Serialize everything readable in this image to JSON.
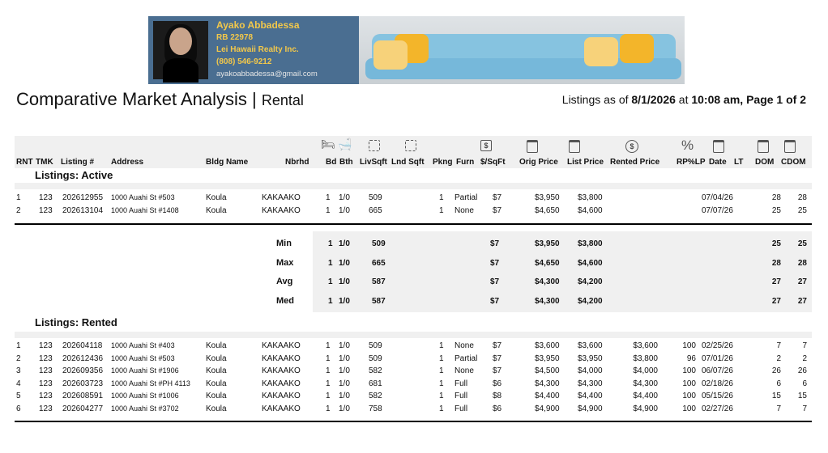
{
  "agent": {
    "name": "Ayako Abbadessa",
    "license": "RB 22978",
    "company": "Lei Hawaii Realty Inc.",
    "phone": "(808) 546-9212",
    "email": "ayakoabbadessa@gmail.com"
  },
  "report": {
    "title": "Comparative Market Analysis",
    "divider": "|",
    "subtitle": "Rental",
    "listings_as_prefix": "Listings as of",
    "date": "8/1/2026",
    "at": "at",
    "time_page": "10:08 am, Page 1 of 2"
  },
  "columns": {
    "rnt": "RNT",
    "tmk": "TMK",
    "listing": "Listing #",
    "address": "Address",
    "bldg": "Bldg Name",
    "nbrhd": "Nbrhd",
    "bd": "Bd",
    "bth": "Bth",
    "livsqft": "LivSqft",
    "lndsqft": "Lnd Sqft",
    "pkng": "Pkng",
    "furn": "Furn",
    "psqft": "$/SqFt",
    "orig": "Orig Price",
    "list": "List Price",
    "rented": "Rented Price",
    "rplp": "RP%LP",
    "date": "Date",
    "lt": "LT",
    "dom": "DOM",
    "cdom": "CDOM"
  },
  "icons": {
    "bed": "bed-icon",
    "bath": "bath-icon",
    "sqft": "area-icon",
    "dollar": "dollar-box-icon",
    "price": "price-tag-icon",
    "coin": "dollar-coin-icon",
    "percent": "percent-icon",
    "calendar": "calendar-icon",
    "percent_glyph": "%",
    "dollar_glyph": "$"
  },
  "active": {
    "heading": "Listings: Active",
    "rows": [
      {
        "n": "1",
        "tmk": "123",
        "listing": "202612955",
        "address": "1000 Auahi St #503",
        "bldg": "Koula",
        "nbrhd": "KAKAAKO",
        "bd": "1",
        "bth": "1/0",
        "liv": "509",
        "pk": "1",
        "furn": "Partial",
        "psf": "$7",
        "orig": "$3,950",
        "list": "$3,800",
        "rented": "",
        "rplp": "",
        "date": "07/04/26",
        "dom": "28",
        "cdom": "28"
      },
      {
        "n": "2",
        "tmk": "123",
        "listing": "202613104",
        "address": "1000 Auahi St #1408",
        "bldg": "Koula",
        "nbrhd": "KAKAAKO",
        "bd": "1",
        "bth": "1/0",
        "liv": "665",
        "pk": "1",
        "furn": "None",
        "psf": "$7",
        "orig": "$4,650",
        "list": "$4,600",
        "rented": "",
        "rplp": "",
        "date": "07/07/26",
        "dom": "25",
        "cdom": "25"
      }
    ]
  },
  "stats": [
    {
      "label": "Min",
      "bd": "1",
      "bth": "1/0",
      "liv": "509",
      "psf": "$7",
      "orig": "$3,950",
      "list": "$3,800",
      "dom": "25",
      "cdom": "25"
    },
    {
      "label": "Max",
      "bd": "1",
      "bth": "1/0",
      "liv": "665",
      "psf": "$7",
      "orig": "$4,650",
      "list": "$4,600",
      "dom": "28",
      "cdom": "28"
    },
    {
      "label": "Avg",
      "bd": "1",
      "bth": "1/0",
      "liv": "587",
      "psf": "$7",
      "orig": "$4,300",
      "list": "$4,200",
      "dom": "27",
      "cdom": "27"
    },
    {
      "label": "Med",
      "bd": "1",
      "bth": "1/0",
      "liv": "587",
      "psf": "$7",
      "orig": "$4,300",
      "list": "$4,200",
      "dom": "27",
      "cdom": "27"
    }
  ],
  "rented": {
    "heading": "Listings: Rented",
    "rows": [
      {
        "n": "1",
        "tmk": "123",
        "listing": "202604118",
        "address": "1000 Auahi St #403",
        "bldg": "Koula",
        "nbrhd": "KAKAAKO",
        "bd": "1",
        "bth": "1/0",
        "liv": "509",
        "pk": "1",
        "furn": "None",
        "psf": "$7",
        "orig": "$3,600",
        "list": "$3,600",
        "rented": "$3,600",
        "rplp": "100",
        "date": "02/25/26",
        "dom": "7",
        "cdom": "7"
      },
      {
        "n": "2",
        "tmk": "123",
        "listing": "202612436",
        "address": "1000 Auahi St #503",
        "bldg": "Koula",
        "nbrhd": "KAKAAKO",
        "bd": "1",
        "bth": "1/0",
        "liv": "509",
        "pk": "1",
        "furn": "Partial",
        "psf": "$7",
        "orig": "$3,950",
        "list": "$3,950",
        "rented": "$3,800",
        "rplp": "96",
        "date": "07/01/26",
        "dom": "2",
        "cdom": "2"
      },
      {
        "n": "3",
        "tmk": "123",
        "listing": "202609356",
        "address": "1000 Auahi St #1906",
        "bldg": "Koula",
        "nbrhd": "KAKAAKO",
        "bd": "1",
        "bth": "1/0",
        "liv": "582",
        "pk": "1",
        "furn": "None",
        "psf": "$7",
        "orig": "$4,500",
        "list": "$4,000",
        "rented": "$4,000",
        "rplp": "100",
        "date": "06/07/26",
        "dom": "26",
        "cdom": "26"
      },
      {
        "n": "4",
        "tmk": "123",
        "listing": "202603723",
        "address": "1000 Auahi St #PH 4113",
        "bldg": "Koula",
        "nbrhd": "KAKAAKO",
        "bd": "1",
        "bth": "1/0",
        "liv": "681",
        "pk": "1",
        "furn": "Full",
        "psf": "$6",
        "orig": "$4,300",
        "list": "$4,300",
        "rented": "$4,300",
        "rplp": "100",
        "date": "02/18/26",
        "dom": "6",
        "cdom": "6"
      },
      {
        "n": "5",
        "tmk": "123",
        "listing": "202608591",
        "address": "1000 Auahi St #1006",
        "bldg": "Koula",
        "nbrhd": "KAKAAKO",
        "bd": "1",
        "bth": "1/0",
        "liv": "582",
        "pk": "1",
        "furn": "Full",
        "psf": "$8",
        "orig": "$4,400",
        "list": "$4,400",
        "rented": "$4,400",
        "rplp": "100",
        "date": "05/15/26",
        "dom": "15",
        "cdom": "15"
      },
      {
        "n": "6",
        "tmk": "123",
        "listing": "202604277",
        "address": "1000 Auahi St #3702",
        "bldg": "Koula",
        "nbrhd": "KAKAAKO",
        "bd": "1",
        "bth": "1/0",
        "liv": "758",
        "pk": "1",
        "furn": "Full",
        "psf": "$6",
        "orig": "$4,900",
        "list": "$4,900",
        "rented": "$4,900",
        "rplp": "100",
        "date": "02/27/26",
        "dom": "7",
        "cdom": "7"
      }
    ]
  }
}
